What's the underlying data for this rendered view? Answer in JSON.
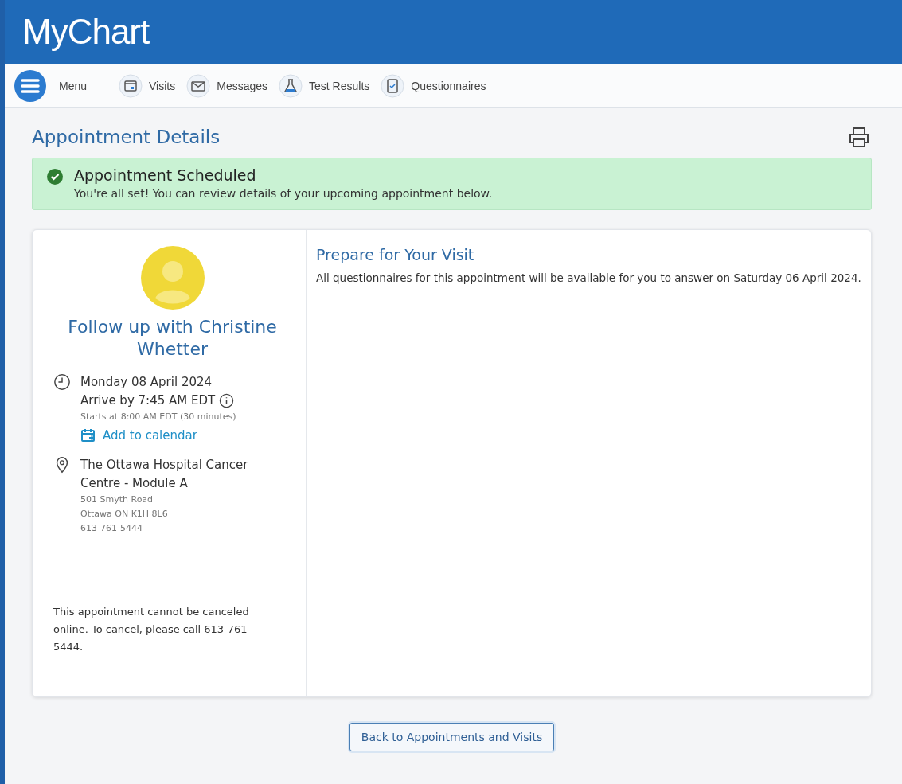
{
  "header": {
    "logo": "MyChart"
  },
  "nav": {
    "menu": "Menu",
    "items": [
      {
        "label": "Visits",
        "kind": "calendar"
      },
      {
        "label": "Messages",
        "kind": "envelope"
      },
      {
        "label": "Test Results",
        "kind": "flask"
      },
      {
        "label": "Questionnaires",
        "kind": "checklist"
      }
    ]
  },
  "page": {
    "title": "Appointment Details"
  },
  "alert": {
    "title": "Appointment Scheduled",
    "message": "You're all set! You can review details of your upcoming appointment below."
  },
  "appointment": {
    "title": "Follow up with Christine Whetter",
    "date": "Monday 08 April 2024",
    "arrive": "Arrive by 7:45 AM EDT",
    "starts": "Starts at 8:00 AM EDT (30 minutes)",
    "calendar_link": "Add to calendar",
    "location": [
      "The Ottawa Hospital Cancer",
      "Centre - Module A"
    ],
    "address": [
      "501 Smyth Road",
      "Ottawa ON K1H 8L6",
      "613-761-5444"
    ],
    "cancel_note": "This appointment cannot be canceled online. To cancel, please call 613-761-5444."
  },
  "prepare": {
    "title": "Prepare for Your Visit",
    "text": "All questionnaires for this appointment will be available for you to answer on Saturday 06 April 2024."
  },
  "back_button": "Back to Appointments and Visits"
}
